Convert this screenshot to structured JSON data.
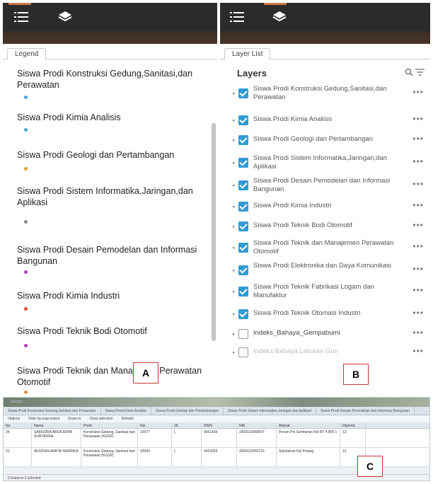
{
  "left_panel": {
    "tab_label": "Legend",
    "items": [
      {
        "label": "Siswa Prodi Konstruksi Gedung,Sanitasi,dan Perawatan",
        "dot_color": "#4aa3df"
      },
      {
        "label": "Siswa Prodi Kimia Analisis",
        "dot_color": "#4aa3df"
      },
      {
        "label": "Siswa Prodi Geologi dan Pertambangan",
        "dot_color": "#e0a030"
      },
      {
        "label": "Siswa Prodi Sistem Informatika,Jaringan,dan Aplikasi",
        "dot_color": "#888888"
      },
      {
        "label": "Siswa Prodi Desain Pemodelan dan Informasi Bangunan",
        "dot_color": "#b040c0"
      },
      {
        "label": "Siswa Prodi Kimia Industri",
        "dot_color": "#e05030"
      },
      {
        "label": "Siswa Prodi Teknik Bodi Otomotif",
        "dot_color": "#b040c0"
      },
      {
        "label": "Siswa Prodi Teknik dan Manajemen Perawatan Otomotif",
        "dot_color": "#e08030"
      }
    ],
    "marker": "A"
  },
  "right_panel": {
    "tab_label": "Layer List",
    "title": "Layers",
    "layers": [
      {
        "label": "Siswa Prodi Konstruksi Gedung,Sanitasi,dan Perawatan",
        "checked": true
      },
      {
        "label": "Siswa Prodi Kimia Analisis",
        "checked": true
      },
      {
        "label": "Siswa Prodi Geologi dan Pertambangan",
        "checked": true
      },
      {
        "label": "Siswa Prodi Sistem Informatika,Jaringan,dan Aplikasi",
        "checked": true
      },
      {
        "label": "Siswa Prodi Desain Pemodelan dan Informasi Bangunan",
        "checked": true
      },
      {
        "label": "Siswa Prodi Kimia Industri",
        "checked": true
      },
      {
        "label": "Siswa Prodi Teknik Bodi Otomotif",
        "checked": true
      },
      {
        "label": "Siswa Prodi Teknik dan Manajemen Perawatan Otomotif",
        "checked": true
      },
      {
        "label": "Siswa Prodi Elektronika dan Daya Komunikasi",
        "checked": true
      },
      {
        "label": "Siswa Prodi Teknik Fabrikasi Logam dan Manufaktur",
        "checked": true
      },
      {
        "label": "Siswa Prodi Teknik Otomasi Industri",
        "checked": true
      },
      {
        "label": "Indeks_Bahaya_Gempabumi",
        "checked": false
      },
      {
        "label": "Indeks Bahaya Letusan Gun",
        "checked": false
      }
    ],
    "more_label": "•••",
    "marker": "B"
  },
  "bottom": {
    "tabs": [
      "Siswa Prodi Konstruksi Gedung,Sanitasi,dan Perawatan",
      "Siswa Prodi Kimia Analisis",
      "Siswa Prodi Geologi dan Pertambangan",
      "Siswa Prodi Sistem Informatika,Jaringan,dan Aplikasi",
      "Siswa Prodi Desain Pemodelan dan Informasi Bangunan"
    ],
    "actions": [
      "Options",
      "Filter by map extent",
      "Zoom to",
      "Clear selection",
      "Refresh"
    ],
    "columns": [
      "No",
      "Nama",
      "Prodi",
      "Nis",
      "JK",
      "NISN",
      "NIK",
      "Alamat",
      "Dtpemb"
    ],
    "rows": [
      [
        "24",
        "SAMUDRA ARDA ERPA SURYADRA",
        "Konstruksi Gedung, Sanitasi dan Perawatan (KGSP)",
        "15077",
        "L",
        "0061426",
        "3309110060007",
        "Perum Pni Sumberan Kel RT 4 RW 1",
        "13"
      ],
      [
        "31",
        "MUDDAN ARIFIN NASRIKA",
        "Konstruksi Gedung, Sanitasi dan Perawatan (KGSP)",
        "15083",
        "L",
        "0429353",
        "3309110050715",
        "Sekolahan Kel Pelang",
        "13"
      ]
    ],
    "status": "0 features 2 selected",
    "marker": "C"
  }
}
